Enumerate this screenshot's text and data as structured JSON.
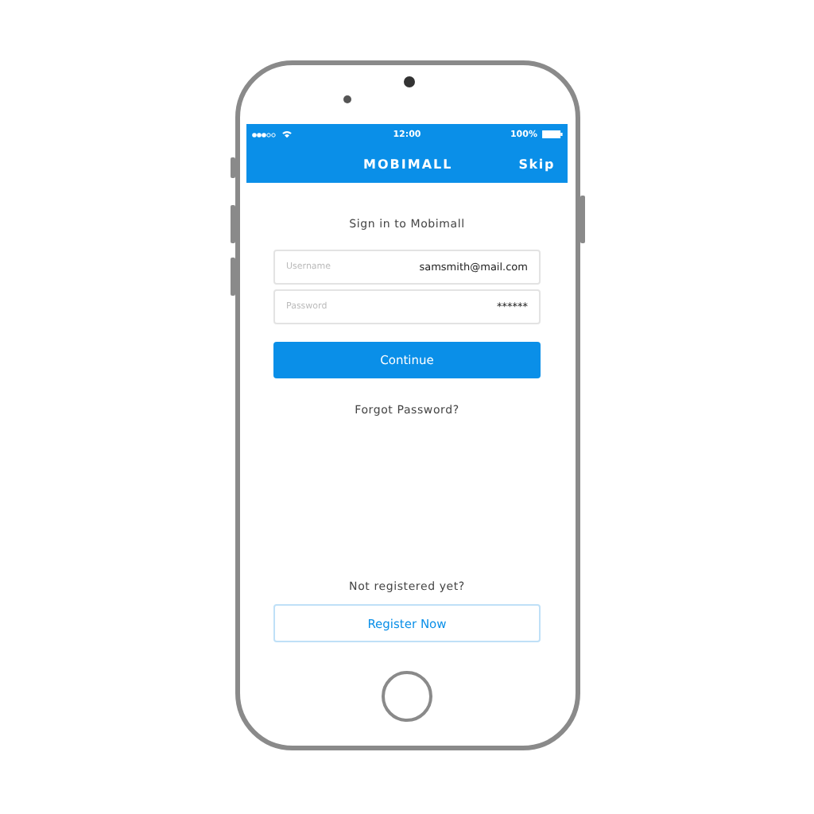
{
  "status_bar": {
    "time": "12:00",
    "battery": "100%"
  },
  "nav_bar": {
    "title": "MOBIMALL",
    "skip": "Skip"
  },
  "heading": "Sign in to Mobimall",
  "fields": [
    {
      "label": "Username",
      "value": "samsmith@mail.com"
    },
    {
      "label": "Password",
      "value": "******"
    }
  ],
  "continue_button": "Continue",
  "forgot_link": "Forgot Password?",
  "register_prompt": "Not registered yet?",
  "register_button": "Register Now"
}
